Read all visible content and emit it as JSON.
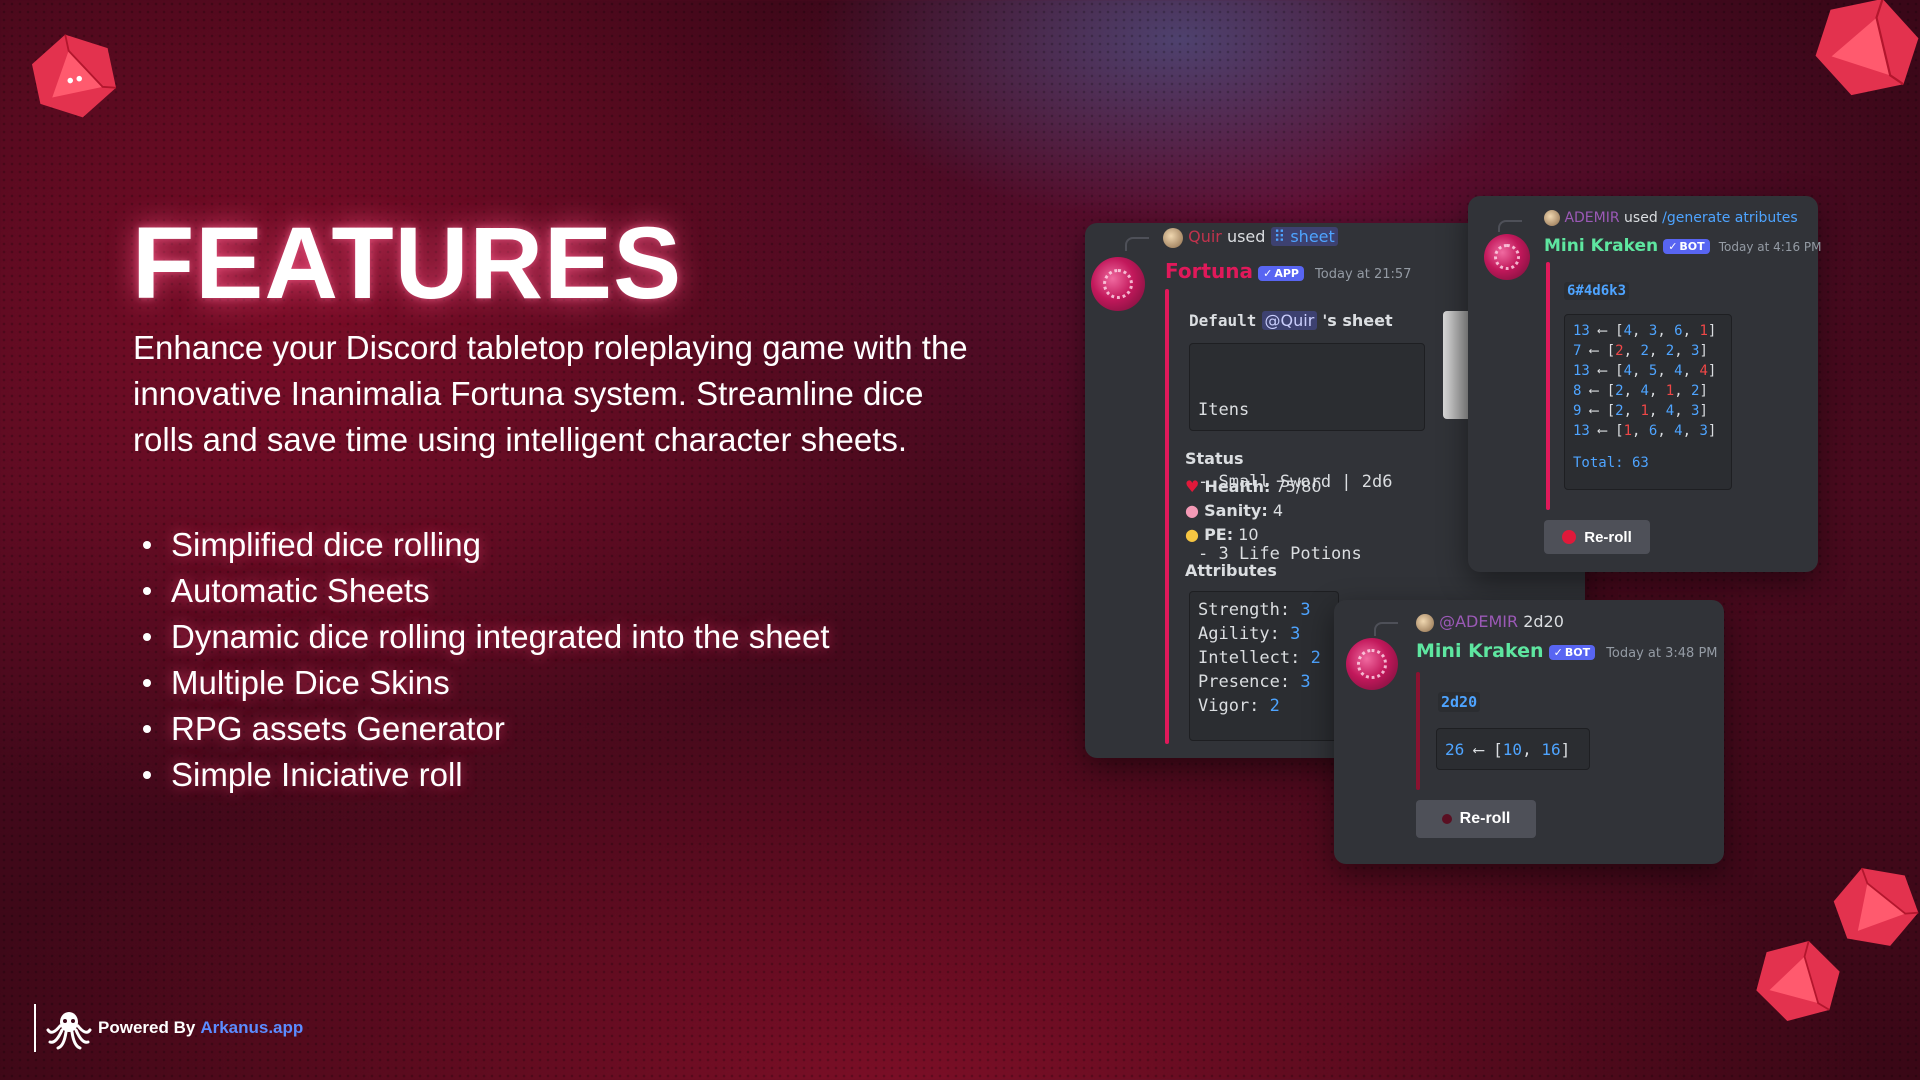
{
  "title": "FEATURES",
  "description": "Enhance your Discord tabletop roleplaying game with the innovative Inanimalia Fortuna system. Streamline dice rolls and save time using intelligent character sheets.",
  "features": [
    "Simplified dice rolling",
    "Automatic Sheets",
    "Dynamic dice rolling integrated into the sheet",
    "Multiple Dice Skins",
    "RPG assets Generator",
    "Simple Iniciative roll"
  ],
  "footer": {
    "powered_by": "Powered By",
    "link": "Arkanus.app"
  },
  "colors": {
    "accent": "#e0195a",
    "link": "#5b8cff",
    "discord_bg": "#313338",
    "badge": "#5865f2"
  },
  "card_fortuna": {
    "reply_user": "Quir",
    "reply_used": "used",
    "reply_command": "sheet",
    "author": "Fortuna",
    "badge": "APP",
    "timestamp": "Today at 21:57",
    "sheet_default": "Default",
    "sheet_mention": "@Quir",
    "sheet_suffix": "'s sheet",
    "items_lines": [
      "Itens",
      "- Small Sword | 2d6",
      "- 3 Life Potions"
    ],
    "status_title": "Status",
    "health_label": "Health:",
    "health_value": "75/80",
    "sanity_label": "Sanity:",
    "sanity_value": "4",
    "pe_label": "PE:",
    "pe_value": "10",
    "attributes_title": "Attributes",
    "attributes": [
      {
        "label": "Strength:",
        "value": "3"
      },
      {
        "label": "Agility:",
        "value": "3"
      },
      {
        "label": "Intellect:",
        "value": "2"
      },
      {
        "label": "Presence:",
        "value": "3"
      },
      {
        "label": "Vigor:",
        "value": "2"
      }
    ]
  },
  "card_attributes": {
    "reply_user": "ADEMIR",
    "reply_used": "used",
    "reply_command": "/generate atributes",
    "author": "Mini Kraken",
    "badge": "BOT",
    "timestamp": "Today at 4:16 PM",
    "roll_expr": "6#4d6k3",
    "rolls": [
      {
        "total": "13",
        "dice": [
          "4",
          "3",
          "6",
          "1"
        ],
        "dropped": [
          3
        ]
      },
      {
        "total": "7",
        "dice": [
          "2",
          "2",
          "2",
          "3"
        ],
        "dropped": [
          0
        ]
      },
      {
        "total": "13",
        "dice": [
          "4",
          "5",
          "4",
          "4"
        ],
        "dropped": [
          3
        ]
      },
      {
        "total": "8",
        "dice": [
          "2",
          "4",
          "1",
          "2"
        ],
        "dropped": [
          2
        ]
      },
      {
        "total": "9",
        "dice": [
          "2",
          "1",
          "4",
          "3"
        ],
        "dropped": [
          1
        ]
      },
      {
        "total": "13",
        "dice": [
          "1",
          "6",
          "4",
          "3"
        ],
        "dropped": [
          0
        ]
      }
    ],
    "total_line": "Total: 63",
    "button": "Re-roll"
  },
  "card_2d20": {
    "reply_user": "@ADEMIR",
    "reply_text": "2d20",
    "author": "Mini Kraken",
    "badge": "BOT",
    "timestamp": "Today at 3:48 PM",
    "roll_expr": "2d20",
    "result_total": "26",
    "result_dice": [
      "10",
      "16"
    ],
    "button": "Re-roll"
  }
}
